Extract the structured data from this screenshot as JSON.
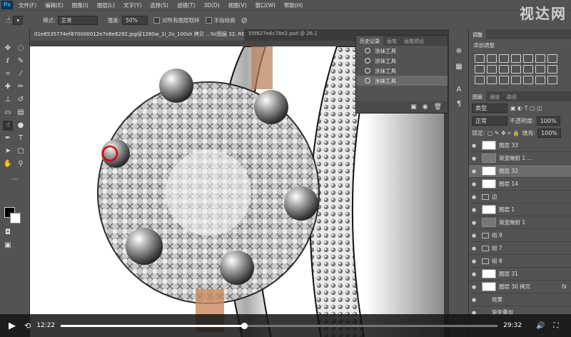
{
  "app": {
    "logo": "Ps",
    "watermark": "视达网"
  },
  "menubar": [
    "文件(F)",
    "编辑(E)",
    "图像(I)",
    "图层(L)",
    "文字(Y)",
    "选择(S)",
    "滤镜(T)",
    "3D(D)",
    "视图(V)",
    "窗口(W)",
    "帮助(H)"
  ],
  "options": {
    "mode_label": "模式:",
    "mode_value": "正常",
    "strength_label": "强度:",
    "strength_value": "50%",
    "sample_label": "对所有图层取样",
    "finger_label": "手指绘画"
  },
  "tabs": [
    {
      "label": "01e6535774ef870000012e7e6e6292.jpg@1280w_1l_2o_100sh 拷贝 ...%(图层 32, RGB/8#) *"
    },
    {
      "label": "55f627e6c78e2.psd @ 26.1"
    }
  ],
  "history": {
    "tabs": [
      "历史记录",
      "画笔",
      "画笔预设"
    ],
    "items": [
      "涂抹工具",
      "涂抹工具",
      "涂抹工具",
      "涂抹工具"
    ],
    "selected_index": 3
  },
  "adjust": {
    "tab": "调整",
    "title": "添加调整"
  },
  "layers": {
    "tabs": [
      "图层",
      "通道",
      "路径"
    ],
    "filter_label": "类型",
    "blend_mode": "正常",
    "opacity_label": "不透明度:",
    "opacity_value": "100%",
    "lock_label": "锁定:",
    "fill_label": "填充:",
    "fill_value": "100%",
    "rows": [
      {
        "name": "图层 33",
        "kind": "layer"
      },
      {
        "name": "渐变映射 1 ...",
        "kind": "adjust"
      },
      {
        "name": "图层 32",
        "kind": "layer"
      },
      {
        "name": "图层 14",
        "kind": "layer"
      },
      {
        "name": "边",
        "kind": "group"
      },
      {
        "name": "图层 1",
        "kind": "layer"
      },
      {
        "name": "渐变映射 1",
        "kind": "adjust"
      },
      {
        "name": "组 9",
        "kind": "group"
      },
      {
        "name": "组 7",
        "kind": "group"
      },
      {
        "name": "组 8",
        "kind": "group"
      },
      {
        "name": "图层 31",
        "kind": "layer"
      },
      {
        "name": "图层 30 拷贝",
        "kind": "layer",
        "fx": "fx"
      },
      {
        "name": "效果",
        "kind": "effect"
      },
      {
        "name": "渐变叠加",
        "kind": "effect"
      }
    ],
    "active_index": 2
  },
  "player": {
    "current": "12:22",
    "duration": "29:32",
    "progress": 0.42
  }
}
